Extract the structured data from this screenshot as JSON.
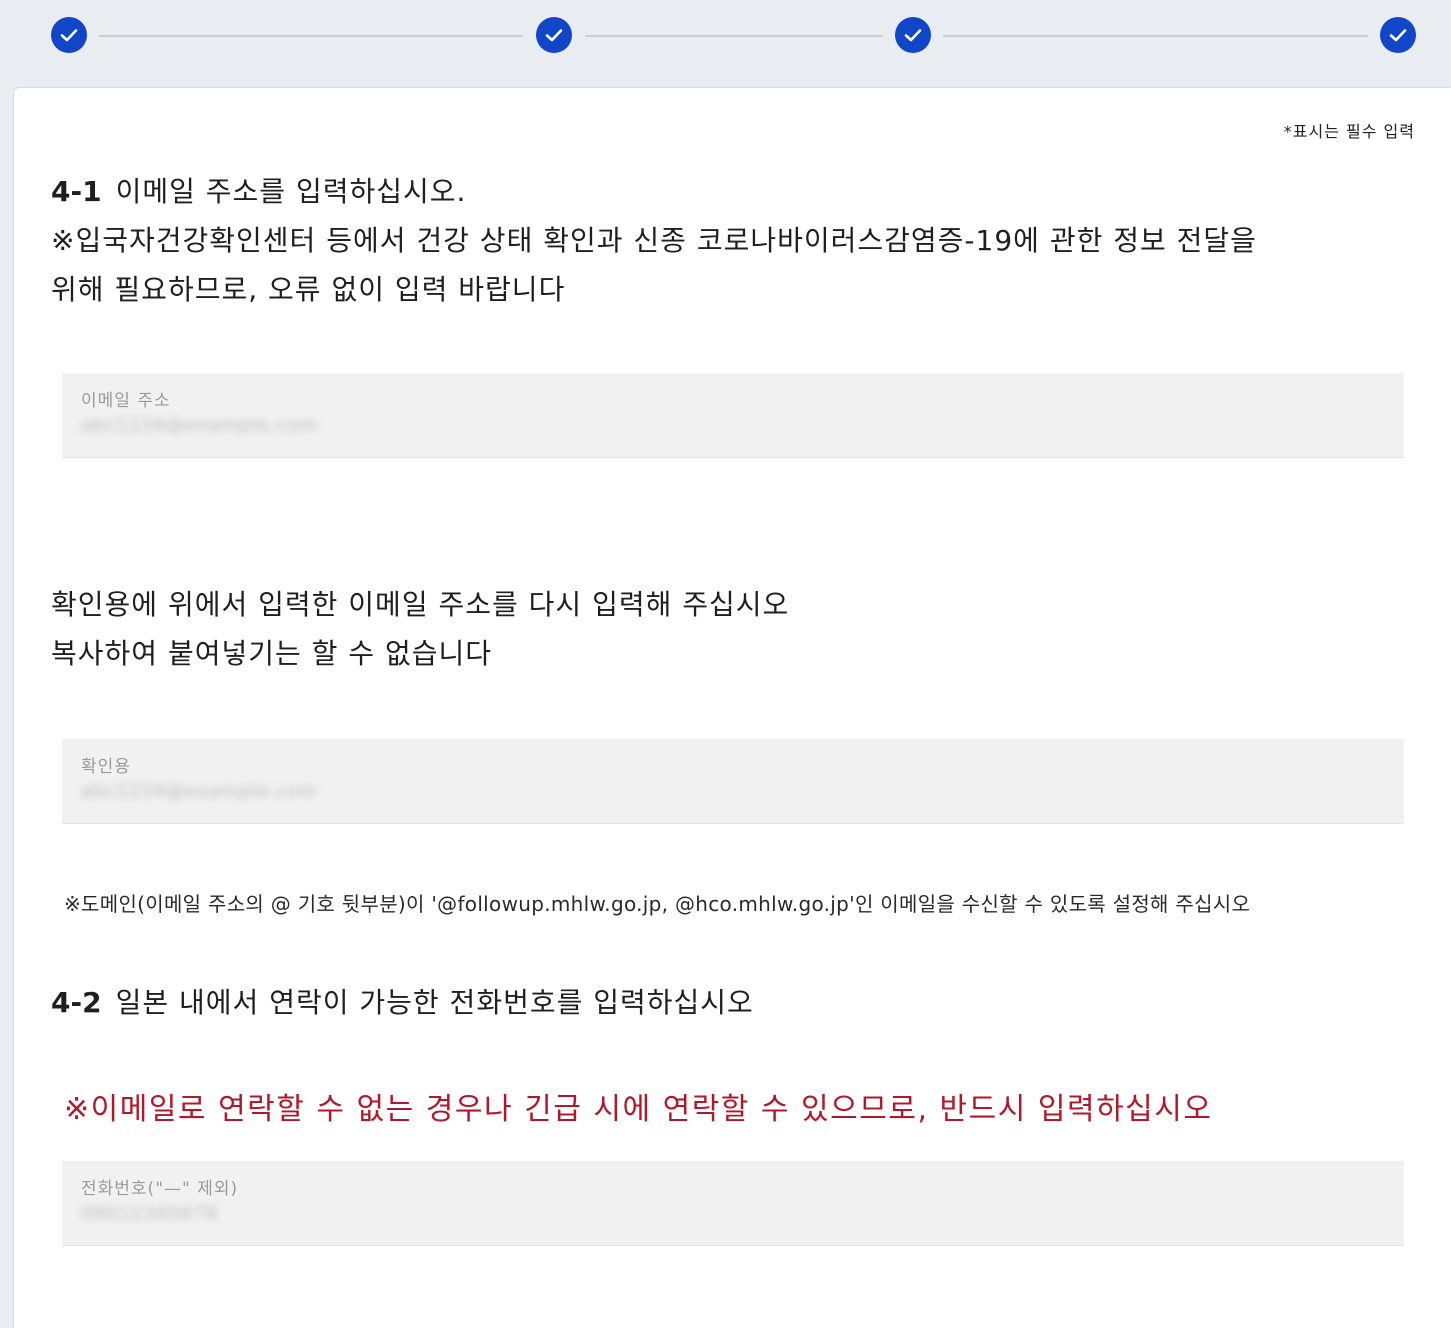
{
  "stepper": {
    "steps": [
      {
        "state": "completed",
        "icon": "check-icon"
      },
      {
        "state": "completed",
        "icon": "check-icon"
      },
      {
        "state": "completed",
        "icon": "check-icon"
      },
      {
        "state": "completed",
        "icon": "check-icon"
      }
    ],
    "accent_color": "#1246c8"
  },
  "form": {
    "required_note": "*표시는 필수 입력",
    "q41": {
      "number": "4-1",
      "title": "이메일 주소를 입력하십시오.",
      "line2": "※입국자건강확인센터 등에서 건강 상태 확인과 신종 코로나바이러스감염증-19에 관한 정보 전달을",
      "line3": "위해 필요하므로, 오류 없이 입력 바랍니다"
    },
    "email": {
      "label": "이메일 주소",
      "value": "abc1234@example.com"
    },
    "confirm_prompt": {
      "line1": "확인용에 위에서 입력한 이메일 주소를 다시 입력해 주십시오",
      "line2": "복사하여 붙여넣기는 할 수 없습니다"
    },
    "confirm_email": {
      "label": "확인용",
      "value": "abc1234@example.com"
    },
    "domain_note": "※도메인(이메일 주소의 @ 기호 뒷부분)이 '@followup.mhlw.go.jp, @hco.mhlw.go.jp'인 이메일을 수신할 수 있도록 설정해 주십시오",
    "q42": {
      "number": "4-2",
      "title": "일본 내에서 연락이 가능한 전화번호를 입력하십시오"
    },
    "phone_warning": "※이메일로 연락할 수 없는 경우나 긴급 시에 연락할 수 있으므로, 반드시 입력하십시오",
    "warning_color": "#b3182a",
    "phone": {
      "label": "전화번호(\"—\" 제외)",
      "value": "09012345678"
    }
  }
}
